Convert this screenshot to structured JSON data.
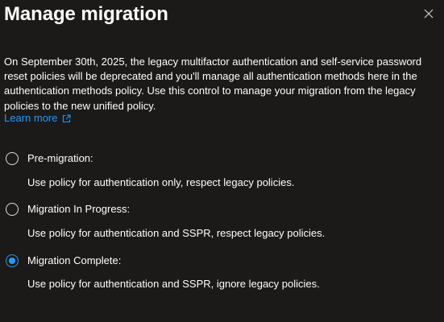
{
  "panel": {
    "title": "Manage migration",
    "close_icon": "close-icon",
    "description": "On September 30th, 2025, the legacy multifactor authentication and self-service password reset policies will be deprecated and you'll manage all authentication methods here in the authentication methods policy. Use this control to manage your migration from the legacy policies to the new unified policy.",
    "learn_more_label": "Learn more",
    "learn_more_icon": "external-link-icon",
    "accent_color": "#2899f5"
  },
  "options": [
    {
      "label": "Pre-migration:",
      "description": "Use policy for authentication only, respect legacy policies.",
      "selected": false
    },
    {
      "label": "Migration In Progress:",
      "description": "Use policy for authentication and SSPR, respect legacy policies.",
      "selected": false
    },
    {
      "label": "Migration Complete:",
      "description": "Use policy for authentication and SSPR, ignore legacy policies.",
      "selected": true
    }
  ]
}
